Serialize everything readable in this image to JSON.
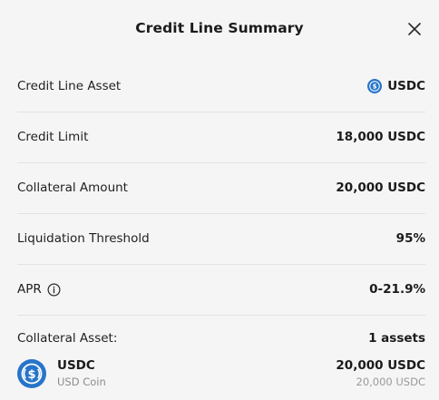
{
  "modal": {
    "title": "Credit Line Summary",
    "close_icon": "close-icon"
  },
  "rows": [
    {
      "label": "Credit Line Asset",
      "value": "USDC",
      "icon": "usdc-coin-icon"
    },
    {
      "label": "Credit Limit",
      "value": "18,000 USDC"
    },
    {
      "label": "Collateral Amount",
      "value": "20,000 USDC"
    },
    {
      "label": "Liquidation Threshold",
      "value": "95%"
    },
    {
      "label": "APR",
      "value": "0-21.9%",
      "icon": "info-icon"
    },
    {
      "label": "Collateral Asset:",
      "value": "1 assets"
    }
  ],
  "collateral_assets": [
    {
      "symbol": "USDC",
      "name": "USD Coin",
      "amount": "20,000 USDC",
      "amount_secondary": "20,000 USDC",
      "icon": "usdc-coin-icon"
    }
  ],
  "colors": {
    "background": "#f5f5f5",
    "text_primary": "#1b1b1b",
    "text_secondary": "#8c8c8c",
    "divider": "#e2e2e2",
    "usdc_blue": "#2775ca"
  }
}
